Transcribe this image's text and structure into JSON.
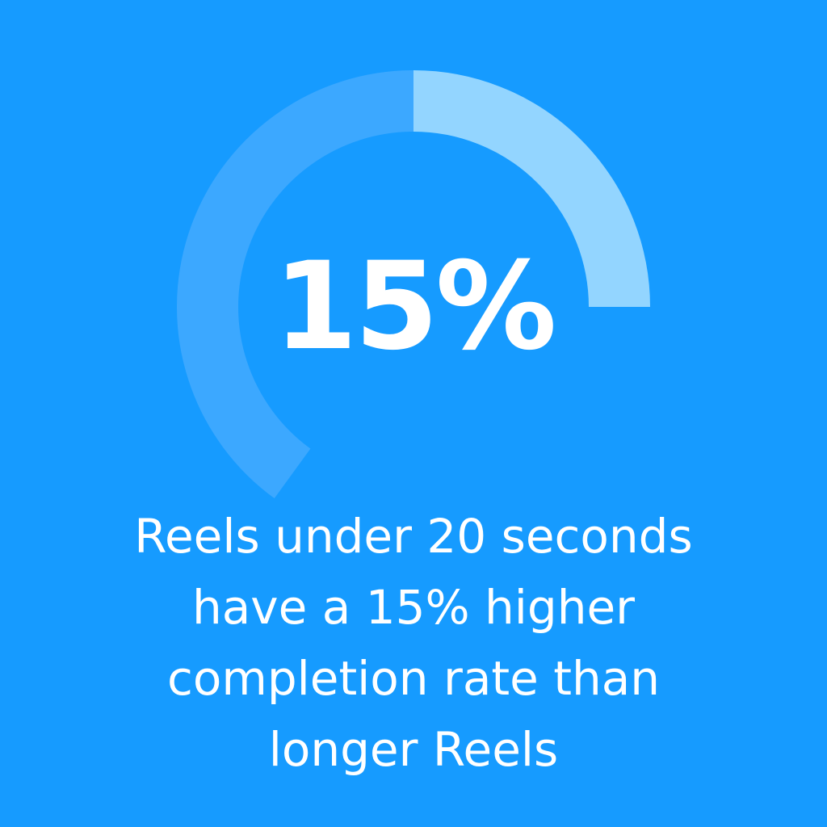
{
  "colors": {
    "background": "#169BFF",
    "track": "#3CA8FF",
    "fill": "#93D5FF",
    "text": "#FFFFFF"
  },
  "chart_data": {
    "type": "gauge",
    "value_percent": 15,
    "value_label": "15%",
    "caption_lines": [
      "Reels under 20 seconds",
      "have a 15% higher",
      "completion rate than",
      "longer Reels"
    ]
  }
}
